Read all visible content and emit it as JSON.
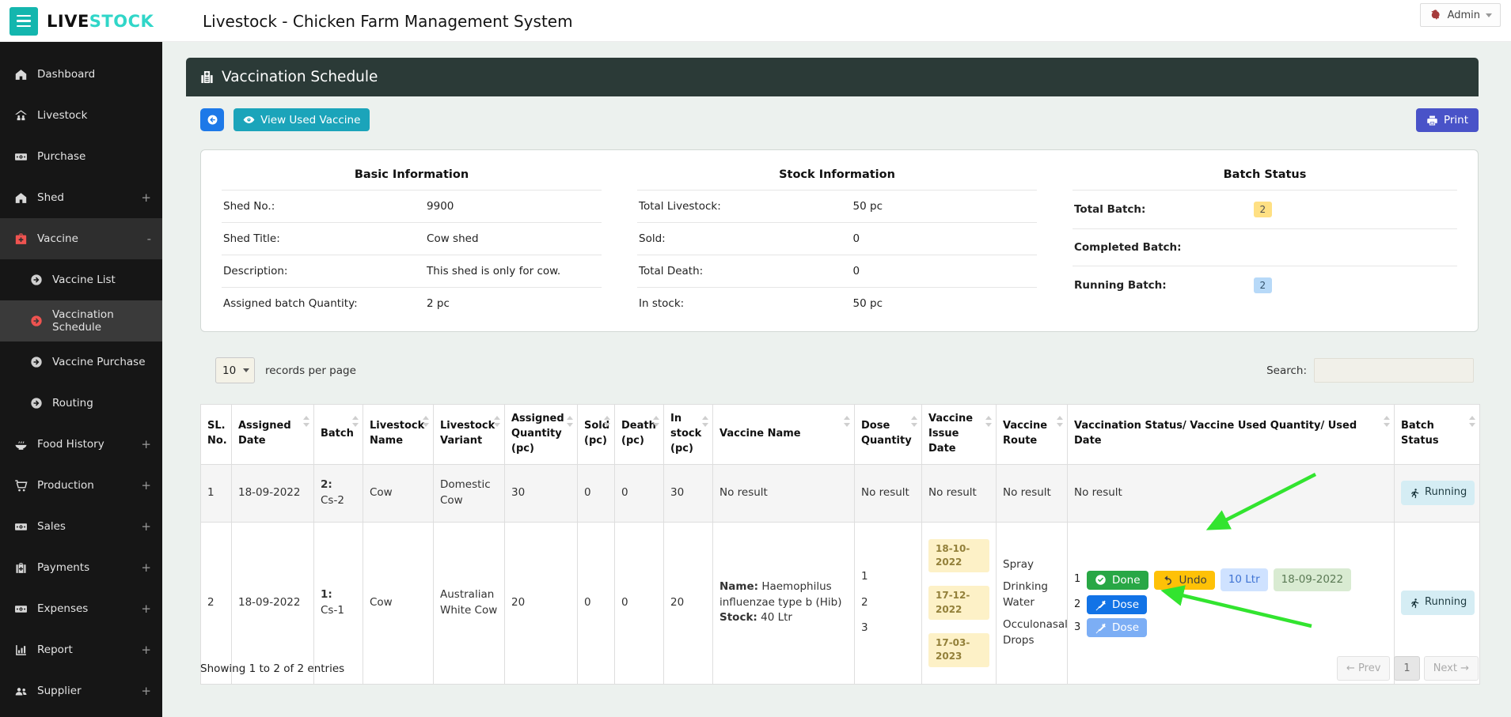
{
  "brand": {
    "name_primary": "LIVE",
    "name_accent": "STOCK"
  },
  "topbar": {
    "title": "Livestock - Chicken Farm Management System",
    "admin_label": "Admin"
  },
  "sidebar": {
    "items": [
      {
        "label": "Dashboard",
        "icon": "home-icon",
        "expand": ""
      },
      {
        "label": "Livestock",
        "icon": "livestock-icon",
        "expand": ""
      },
      {
        "label": "Purchase",
        "icon": "money-icon",
        "expand": ""
      },
      {
        "label": "Shed",
        "icon": "home-icon",
        "expand": "+"
      },
      {
        "label": "Vaccine",
        "icon": "medical-kit-icon",
        "expand": "-"
      },
      {
        "label": "Vaccine List",
        "icon": "arrow-circle-icon",
        "expand": ""
      },
      {
        "label": "Vaccination Schedule",
        "icon": "arrow-circle-icon",
        "expand": ""
      },
      {
        "label": "Vaccine Purchase",
        "icon": "arrow-circle-icon",
        "expand": ""
      },
      {
        "label": "Routing",
        "icon": "arrow-circle-icon",
        "expand": ""
      },
      {
        "label": "Food History",
        "icon": "food-bowl-icon",
        "expand": "+"
      },
      {
        "label": "Production",
        "icon": "cart-icon",
        "expand": "+"
      },
      {
        "label": "Sales",
        "icon": "money-icon",
        "expand": "+"
      },
      {
        "label": "Payments",
        "icon": "briefcase-icon",
        "expand": "+"
      },
      {
        "label": "Expenses",
        "icon": "money-icon",
        "expand": "+"
      },
      {
        "label": "Report",
        "icon": "bar-chart-icon",
        "expand": "+"
      },
      {
        "label": "Supplier",
        "icon": "users-icon",
        "expand": "+"
      }
    ]
  },
  "panel": {
    "title": "Vaccination Schedule"
  },
  "toolbar": {
    "view_used_vaccine_label": "View Used Vaccine",
    "print_label": "Print"
  },
  "info": {
    "basic": {
      "heading": "Basic Information",
      "rows": [
        {
          "label": "Shed No.:",
          "value": "9900"
        },
        {
          "label": "Shed Title:",
          "value": "Cow shed"
        },
        {
          "label": "Description:",
          "value": "This shed is only for cow."
        },
        {
          "label": "Assigned batch Quantity:",
          "value": "2 pc"
        }
      ]
    },
    "stock": {
      "heading": "Stock Information",
      "rows": [
        {
          "label": "Total Livestock:",
          "value": "50 pc"
        },
        {
          "label": "Sold:",
          "value": "0"
        },
        {
          "label": "Total Death:",
          "value": "0"
        },
        {
          "label": "In stock:",
          "value": "50 pc"
        }
      ]
    },
    "batch": {
      "heading": "Batch Status",
      "rows": [
        {
          "label": "Total Batch:",
          "value": "2"
        },
        {
          "label": "Completed Batch:",
          "value": ""
        },
        {
          "label": "Running Batch:",
          "value": "2"
        }
      ]
    }
  },
  "controls": {
    "page_size": "10",
    "records_label": "records per page",
    "search_label": "Search:"
  },
  "table": {
    "headers": [
      "SL. No.",
      "Assigned Date",
      "Batch",
      "Livestock Name",
      "Livestock Variant",
      "Assigned Quantity (pc)",
      "Sold (pc)",
      "Death (pc)",
      "In stock (pc)",
      "Vaccine Name",
      "Dose Quantity",
      "Vaccine Issue Date",
      "Vaccine Route",
      "Vaccination Status/ Vaccine Used Quantity/ Used Date",
      "Batch Status"
    ],
    "rows": [
      {
        "sl": "1",
        "assigned_date": "18-09-2022",
        "batch_line1": "2:",
        "batch_line2": "Cs-2",
        "livestock_name": "Cow",
        "variant": "Domestic Cow",
        "assigned_qty": "30",
        "sold": "0",
        "death": "0",
        "in_stock": "30",
        "no_result": "No result",
        "batch_status": "Running"
      },
      {
        "sl": "2",
        "assigned_date": "18-09-2022",
        "batch_line1": "1:",
        "batch_line2": "Cs-1",
        "livestock_name": "Cow",
        "variant": "Australian White Cow",
        "assigned_qty": "20",
        "sold": "0",
        "death": "0",
        "in_stock": "20",
        "vaccine_name_label": "Name:",
        "vaccine_name": "Haemophilus influenzae type b (Hib)",
        "vaccine_stock_label": "Stock:",
        "vaccine_stock": "40 Ltr",
        "doses": [
          "1",
          "2",
          "3"
        ],
        "issue_dates": [
          "18-10-2022",
          "17-12-2022",
          "17-03-2023"
        ],
        "routes": [
          "Spray",
          "Drinking Water",
          "Occulonasal Drops"
        ],
        "status": {
          "row1": {
            "num": "1",
            "done_label": "Done",
            "undo_label": "Undo",
            "used_qty": "10 Ltr",
            "used_date": "18-09-2022"
          },
          "row2": {
            "num": "2",
            "dose_label": "Dose"
          },
          "row3": {
            "num": "3",
            "dose_label": "Dose"
          }
        },
        "batch_status": "Running"
      }
    ]
  },
  "footer": {
    "showing": "Showing 1 to 2 of 2 entries",
    "prev_label": "← Prev",
    "page": "1",
    "next_label": "Next →"
  },
  "colors": {
    "brand_teal": "#14b6ae",
    "accent_teal": "#1ba4ba",
    "panel_header": "#2b3a37",
    "primary_blue": "#1273e6",
    "print_indigo": "#4953c8",
    "success_green": "#28a745",
    "warning_yellow": "#fec107",
    "arrow_green": "#32e42f"
  }
}
